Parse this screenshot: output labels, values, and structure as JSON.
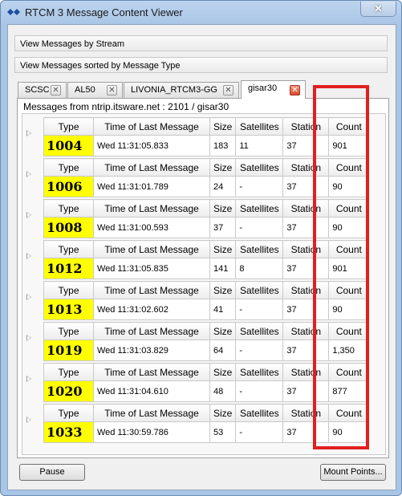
{
  "window": {
    "title": "RTCM 3 Message Content Viewer",
    "close_glyph": "✕"
  },
  "expanders": {
    "by_stream": "View Messages by Stream",
    "by_type": "View Messages sorted by Message Type"
  },
  "tabs": [
    {
      "label": "SCSC",
      "close": "✕"
    },
    {
      "label": "AL50",
      "close": "✕"
    },
    {
      "label": "LIVONIA_RTCM3-GG",
      "close": "✕"
    },
    {
      "label": "gisar30",
      "close": "✕"
    }
  ],
  "panel": {
    "source_label": "Messages from ntrip.itsware.net : 2101 / gisar30"
  },
  "columns": [
    "Type",
    "Time of Last Message",
    "Size",
    "Satellites",
    "Station",
    "Count"
  ],
  "messages": [
    {
      "type": "1004",
      "time": "Wed 11:31:05.833",
      "size": "183",
      "satellites": "11",
      "station": "37",
      "count": "901"
    },
    {
      "type": "1006",
      "time": "Wed 11:31:01.789",
      "size": "24",
      "satellites": "-",
      "station": "37",
      "count": "90"
    },
    {
      "type": "1008",
      "time": "Wed 11:31:00.593",
      "size": "37",
      "satellites": "-",
      "station": "37",
      "count": "90"
    },
    {
      "type": "1012",
      "time": "Wed 11:31:05.835",
      "size": "141",
      "satellites": "8",
      "station": "37",
      "count": "901"
    },
    {
      "type": "1013",
      "time": "Wed 11:31:02.602",
      "size": "41",
      "satellites": "-",
      "station": "37",
      "count": "90"
    },
    {
      "type": "1019",
      "time": "Wed 11:31:03.829",
      "size": "64",
      "satellites": "-",
      "station": "37",
      "count": "1,350"
    },
    {
      "type": "1020",
      "time": "Wed 11:31:04.610",
      "size": "48",
      "satellites": "-",
      "station": "37",
      "count": "877"
    },
    {
      "type": "1033",
      "time": "Wed 11:30:59.786",
      "size": "53",
      "satellites": "-",
      "station": "37",
      "count": "90"
    }
  ],
  "buttons": {
    "pause": "Pause",
    "mount_points": "Mount Points..."
  },
  "colors": {
    "type_highlight": "#ffff00",
    "annotation_box": "#e0201e",
    "active_tab_close": "#d9482a"
  }
}
